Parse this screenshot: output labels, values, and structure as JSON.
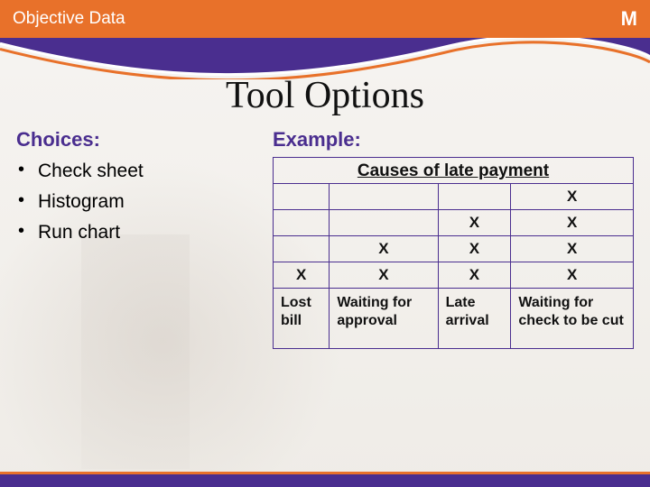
{
  "header": {
    "title": "Objective Data",
    "right_badge": "M"
  },
  "main_title": "Tool Options",
  "choices": {
    "heading": "Choices:",
    "items": [
      "Check sheet",
      "Histogram",
      "Run chart"
    ]
  },
  "example": {
    "heading": "Example:"
  },
  "check_sheet": {
    "caption": "Causes of late payment",
    "columns": [
      "Lost bill",
      "Waiting for approval",
      "Late arrival",
      "Waiting for check to be cut"
    ],
    "mark": "X",
    "grid": [
      [
        "",
        "",
        "",
        "X"
      ],
      [
        "",
        "",
        "X",
        "X"
      ],
      [
        "",
        "X",
        "X",
        "X"
      ],
      [
        "X",
        "X",
        "X",
        "X"
      ]
    ]
  },
  "chart_data": {
    "type": "table",
    "title": "Causes of late payment",
    "categories": [
      "Lost bill",
      "Waiting for approval",
      "Late arrival",
      "Waiting for check to be cut"
    ],
    "values": [
      1,
      2,
      3,
      4
    ]
  }
}
